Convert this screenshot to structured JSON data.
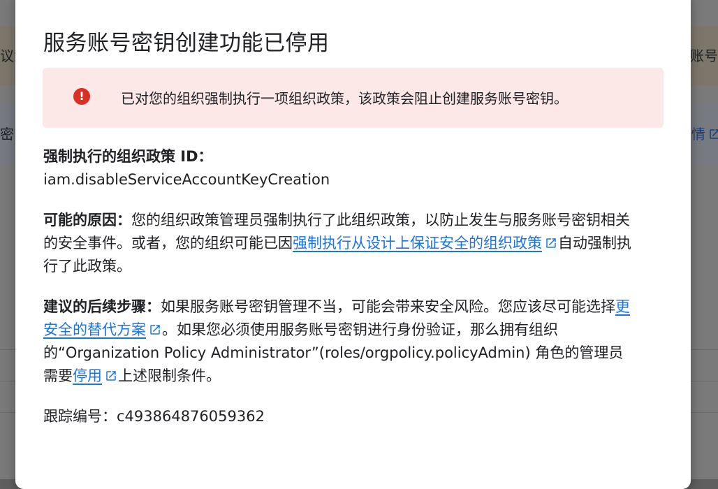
{
  "background": {
    "left_fragment_1": "议您",
    "right_fragment_1": "账号运",
    "left_fragment_2": "密",
    "right_link_fragment": "情"
  },
  "dialog": {
    "title": "服务账号密钥创建功能已停用",
    "alert": {
      "icon": "error-icon",
      "icon_glyph": "!",
      "text": "已对您的组织强制执行一项组织政策，该政策会阻止创建服务账号密钥。"
    },
    "policy": {
      "label": "强制执行的组织政策 ID：",
      "value": "iam.disableServiceAccountKeyCreation"
    },
    "cause": {
      "label": "可能的原因：",
      "text_1": "您的组织政策管理员强制执行了此组织政策，以防止发生与服务账号密钥相关的安全事件。或者，您的组织可能已因",
      "link": "强制执行从设计上保证安全的组织政策",
      "text_2": "自动强制执行了此政策。"
    },
    "next_steps": {
      "label": "建议的后续步骤：",
      "text_1": "如果服务账号密钥管理不当，可能会带来安全风险。您应该尽可能选择",
      "link_1": "更安全的替代方案",
      "text_2": "。如果您必须使用服务账号密钥进行身份验证，那么拥有组织的“Organization Policy Administrator”(roles/orgpolicy.policyAdmin) 角色的管理员需要",
      "link_2": "停用",
      "text_3": "上述限制条件。"
    },
    "tracking": {
      "label": "跟踪编号：",
      "value": "c493864876059362"
    }
  },
  "colors": {
    "accent_link": "#1a73e8",
    "error_red": "#d93025",
    "alert_bg": "#fce8e6"
  }
}
